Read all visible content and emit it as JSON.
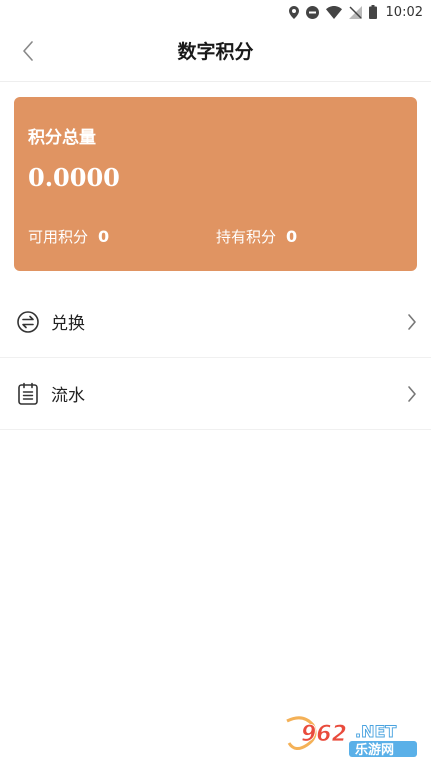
{
  "status_bar": {
    "time": "10:02",
    "icons": [
      "location-icon",
      "do-not-disturb-icon",
      "wifi-icon",
      "no-signal-icon",
      "battery-icon"
    ]
  },
  "header": {
    "title": "数字积分",
    "back_icon": "chevron-left-icon"
  },
  "points_card": {
    "title": "积分总量",
    "total": "0.0000",
    "available_label": "可用积分",
    "available_value": "0",
    "held_label": "持有积分",
    "held_value": "0",
    "background_color": "#e09462"
  },
  "menu": {
    "items": [
      {
        "label": "兑换",
        "icon": "exchange-icon"
      },
      {
        "label": "流水",
        "icon": "ledger-icon"
      }
    ]
  },
  "watermark": {
    "brand": "962.NET",
    "subtitle": "乐游网"
  }
}
